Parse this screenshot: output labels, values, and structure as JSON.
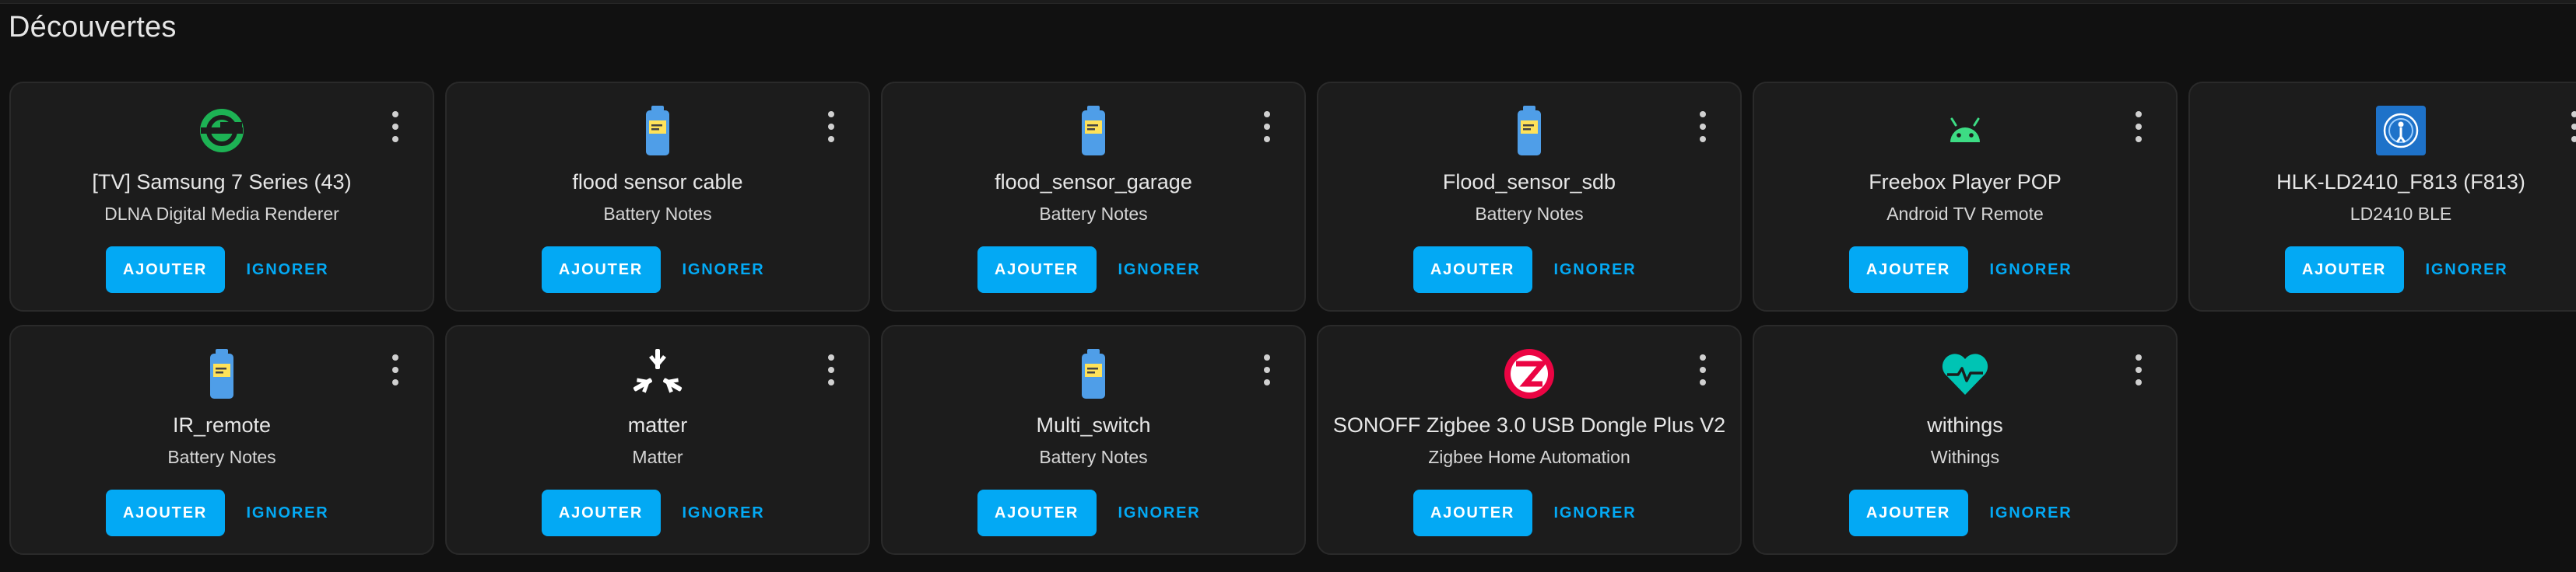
{
  "page": {
    "title": "Découvertes"
  },
  "cards": [
    {
      "name": "[TV] Samsung 7 Series (43)",
      "integration": "DLNA Digital Media Renderer",
      "icon": "dlna-icon",
      "add_label": "AJOUTER",
      "ignore_label": "IGNORER"
    },
    {
      "name": "flood sensor cable",
      "integration": "Battery Notes",
      "icon": "battery-notes-icon",
      "add_label": "AJOUTER",
      "ignore_label": "IGNORER"
    },
    {
      "name": "flood_sensor_garage",
      "integration": "Battery Notes",
      "icon": "battery-notes-icon",
      "add_label": "AJOUTER",
      "ignore_label": "IGNORER"
    },
    {
      "name": "Flood_sensor_sdb",
      "integration": "Battery Notes",
      "icon": "battery-notes-icon",
      "add_label": "AJOUTER",
      "ignore_label": "IGNORER"
    },
    {
      "name": "Freebox Player POP",
      "integration": "Android TV Remote",
      "icon": "android-icon",
      "add_label": "AJOUTER",
      "ignore_label": "IGNORER"
    },
    {
      "name": "HLK-LD2410_F813 (F813)",
      "integration": "LD2410 BLE",
      "icon": "ld2410-icon",
      "add_label": "AJOUTER",
      "ignore_label": "IGNORER"
    },
    {
      "name": "IR_remote",
      "integration": "Battery Notes",
      "icon": "battery-notes-icon",
      "add_label": "AJOUTER",
      "ignore_label": "IGNORER"
    },
    {
      "name": "matter",
      "integration": "Matter",
      "icon": "matter-icon",
      "add_label": "AJOUTER",
      "ignore_label": "IGNORER"
    },
    {
      "name": "Multi_switch",
      "integration": "Battery Notes",
      "icon": "battery-notes-icon",
      "add_label": "AJOUTER",
      "ignore_label": "IGNORER"
    },
    {
      "name": "SONOFF Zigbee 3.0 USB Dongle Plus V2",
      "integration": "Zigbee Home Automation",
      "icon": "zigbee-icon",
      "add_label": "AJOUTER",
      "ignore_label": "IGNORER"
    },
    {
      "name": "withings",
      "integration": "Withings",
      "icon": "withings-icon",
      "add_label": "AJOUTER",
      "ignore_label": "IGNORER"
    }
  ],
  "colors": {
    "accent": "#03a9f4",
    "card_bg": "#1c1c1c",
    "page_bg": "#111111"
  }
}
